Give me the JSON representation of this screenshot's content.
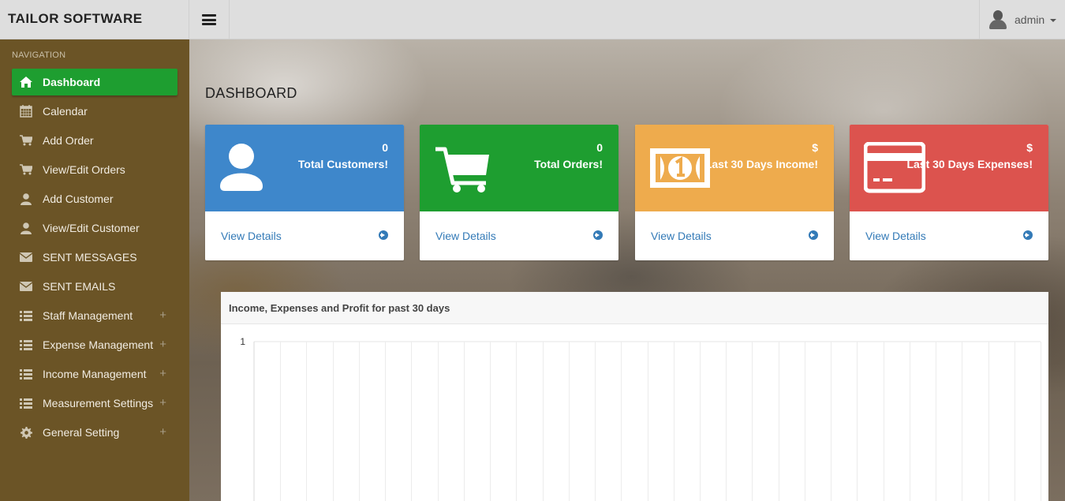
{
  "app": {
    "brand": "TAILOR SOFTWARE"
  },
  "header": {
    "user_name": "admin"
  },
  "sidebar": {
    "section_label": "NAVIGATION",
    "items": [
      {
        "label": "Dashboard",
        "icon": "home-icon",
        "active": true
      },
      {
        "label": "Calendar",
        "icon": "calendar-icon"
      },
      {
        "label": "Add Order",
        "icon": "cart-icon"
      },
      {
        "label": "View/Edit Orders",
        "icon": "cart-icon"
      },
      {
        "label": "Add Customer",
        "icon": "user-icon"
      },
      {
        "label": "View/Edit Customer",
        "icon": "user-icon"
      },
      {
        "label": "SENT MESSAGES",
        "icon": "envelope-icon"
      },
      {
        "label": "SENT EMAILS",
        "icon": "envelope-icon"
      },
      {
        "label": "Staff Management",
        "icon": "list-icon",
        "expandable": true
      },
      {
        "label": "Expense Management",
        "icon": "list-icon",
        "expandable": true
      },
      {
        "label": "Income Management",
        "icon": "list-icon",
        "expandable": true
      },
      {
        "label": "Measurement Settings",
        "icon": "list-icon",
        "expandable": true
      },
      {
        "label": "General Setting",
        "icon": "gear-icon",
        "expandable": true
      }
    ],
    "expand_symbol": "+"
  },
  "main": {
    "page_title": "DASHBOARD",
    "cards": [
      {
        "value": "0",
        "label": "Total Customers!",
        "link": "View Details",
        "color": "#3e87cb",
        "icon": "user-icon"
      },
      {
        "value": "0",
        "label": "Total Orders!",
        "link": "View Details",
        "color": "#1e9e30",
        "icon": "cart-icon"
      },
      {
        "value": "$",
        "label": "Last 30 Days Income!",
        "link": "View Details",
        "color": "#eeab4d",
        "icon": "money-icon"
      },
      {
        "value": "$",
        "label": "Last 30 Days Expenses!",
        "link": "View Details",
        "color": "#dc534e",
        "icon": "credit-card-icon"
      }
    ],
    "panel": {
      "title": "Income, Expenses and Profit for past 30 days",
      "y_tick": "1"
    }
  },
  "chart_data": {
    "type": "line",
    "title": "Income, Expenses and Profit for past 30 days",
    "y_ticks": [
      "1"
    ],
    "ylim": [
      0,
      1
    ],
    "x_gridlines": 30,
    "series": []
  }
}
